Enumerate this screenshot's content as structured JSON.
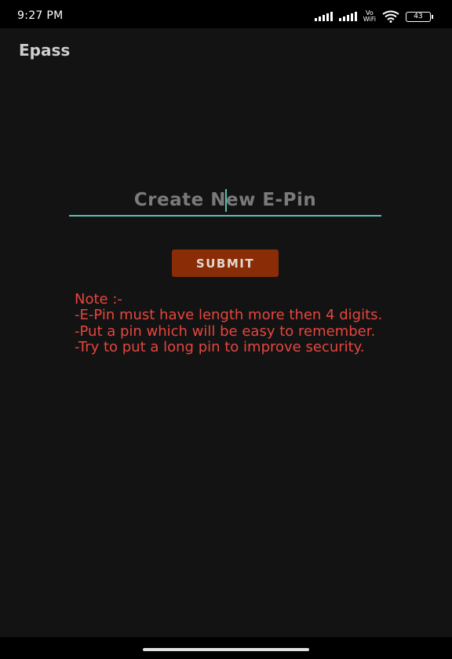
{
  "status_bar": {
    "time": "9:27 PM",
    "volte_label": "Vo",
    "wifi_label": "WiFi",
    "battery": "43"
  },
  "app_bar": {
    "title": "Epass"
  },
  "form": {
    "pin_placeholder": "Create New E-Pin",
    "pin_value": "",
    "submit_label": "SUBMIT"
  },
  "note": {
    "text": "Note :-\n-E-Pin must have length more then 4 digits.\n-Put a pin which will be easy to remember.\n-Try to put a long pin to improve security."
  },
  "colors": {
    "background": "#131313",
    "accent": "#57c2b1",
    "button": "#8a2d06",
    "note_text": "#e5463f"
  }
}
